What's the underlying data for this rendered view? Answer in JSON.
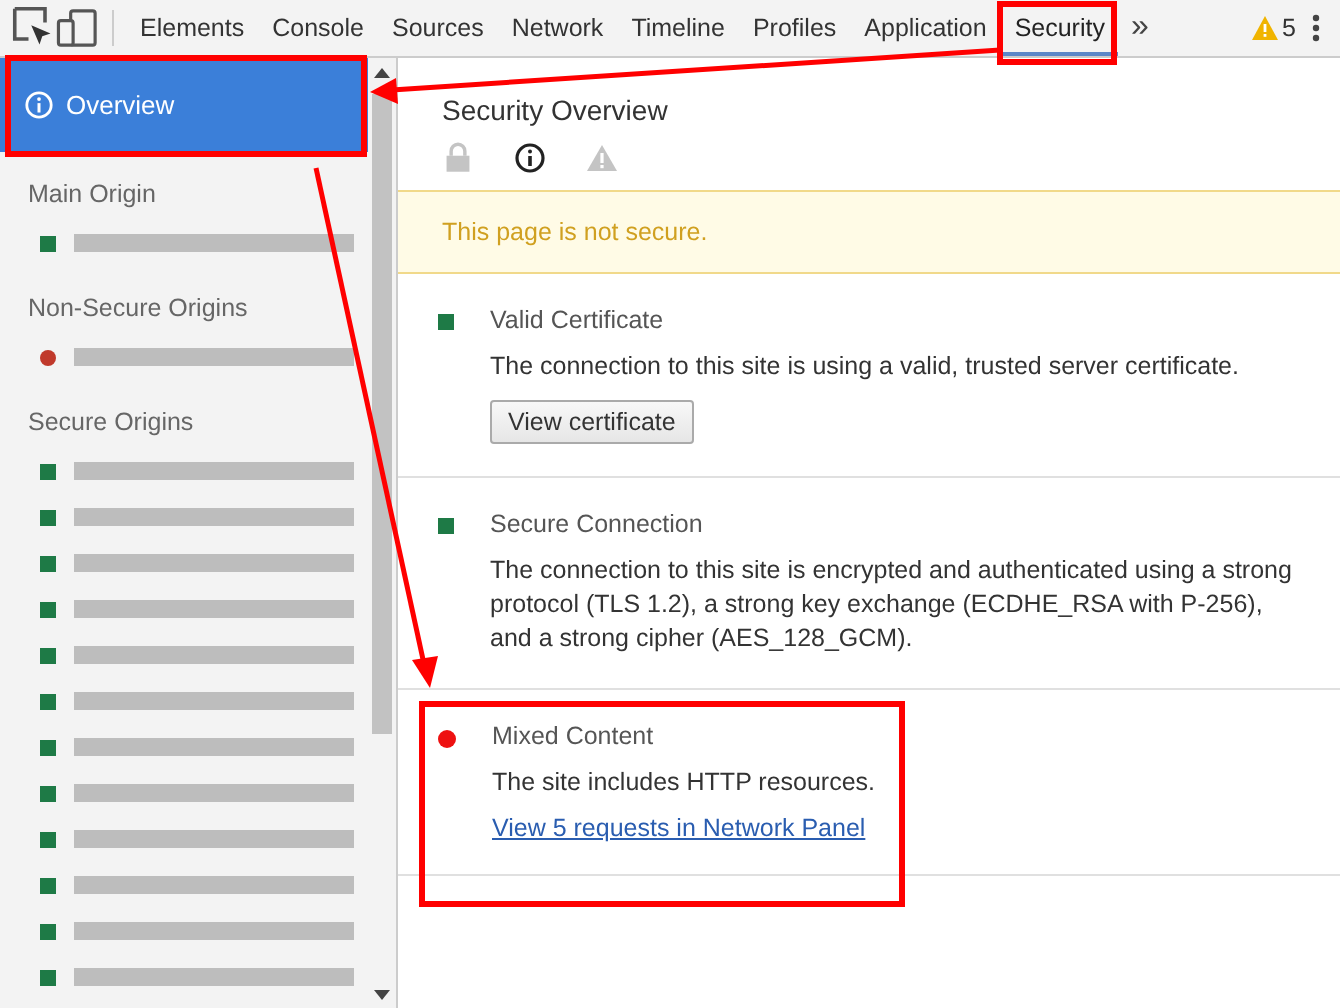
{
  "toolbar": {
    "tabs": [
      {
        "label": "Elements",
        "selected": false
      },
      {
        "label": "Console",
        "selected": false
      },
      {
        "label": "Sources",
        "selected": false
      },
      {
        "label": "Network",
        "selected": false
      },
      {
        "label": "Timeline",
        "selected": false
      },
      {
        "label": "Profiles",
        "selected": false
      },
      {
        "label": "Application",
        "selected": false
      },
      {
        "label": "Security",
        "selected": true
      }
    ],
    "more": "»",
    "warnings": "5"
  },
  "sidebar": {
    "overview": {
      "label": "Overview",
      "selected": true
    },
    "groups": [
      {
        "title": "Main Origin",
        "items": [
          {
            "kind": "secure",
            "color": "#1e7a46"
          }
        ]
      },
      {
        "title": "Non-Secure Origins",
        "items": [
          {
            "kind": "insecure",
            "color": "#c0392b"
          }
        ]
      },
      {
        "title": "Secure Origins",
        "items": [
          {
            "kind": "secure",
            "color": "#1e7a46"
          },
          {
            "kind": "secure",
            "color": "#1e7a46"
          },
          {
            "kind": "secure",
            "color": "#1e7a46"
          },
          {
            "kind": "secure",
            "color": "#1e7a46"
          },
          {
            "kind": "secure",
            "color": "#1e7a46"
          },
          {
            "kind": "secure",
            "color": "#1e7a46"
          },
          {
            "kind": "secure",
            "color": "#1e7a46"
          },
          {
            "kind": "secure",
            "color": "#1e7a46"
          },
          {
            "kind": "secure",
            "color": "#1e7a46"
          },
          {
            "kind": "secure",
            "color": "#1e7a46"
          },
          {
            "kind": "secure",
            "color": "#1e7a46"
          },
          {
            "kind": "secure",
            "color": "#1e7a46"
          }
        ]
      }
    ]
  },
  "main": {
    "title": "Security Overview",
    "summary_icons": [
      {
        "kind": "lock",
        "selected": false
      },
      {
        "kind": "info",
        "selected": true
      },
      {
        "kind": "warning",
        "selected": false
      }
    ],
    "banner": "This page is not secure.",
    "explanations": [
      {
        "kind": "secure",
        "color": "#1e7a46",
        "title": "Valid Certificate",
        "description": "The connection to this site is using a valid, trusted server certificate.",
        "button": "View certificate"
      },
      {
        "kind": "secure",
        "color": "#1e7a46",
        "title": "Secure Connection",
        "description": "The connection to this site is encrypted and authenticated using a strong protocol (TLS 1.2), a strong key exchange (ECDHE_RSA with P-256), and a strong cipher (AES_128_GCM)."
      },
      {
        "kind": "insecure",
        "color": "#ee1111",
        "title": "Mixed Content",
        "description": "The site includes HTTP resources.",
        "link": "View 5 requests in Network Panel"
      }
    ]
  }
}
